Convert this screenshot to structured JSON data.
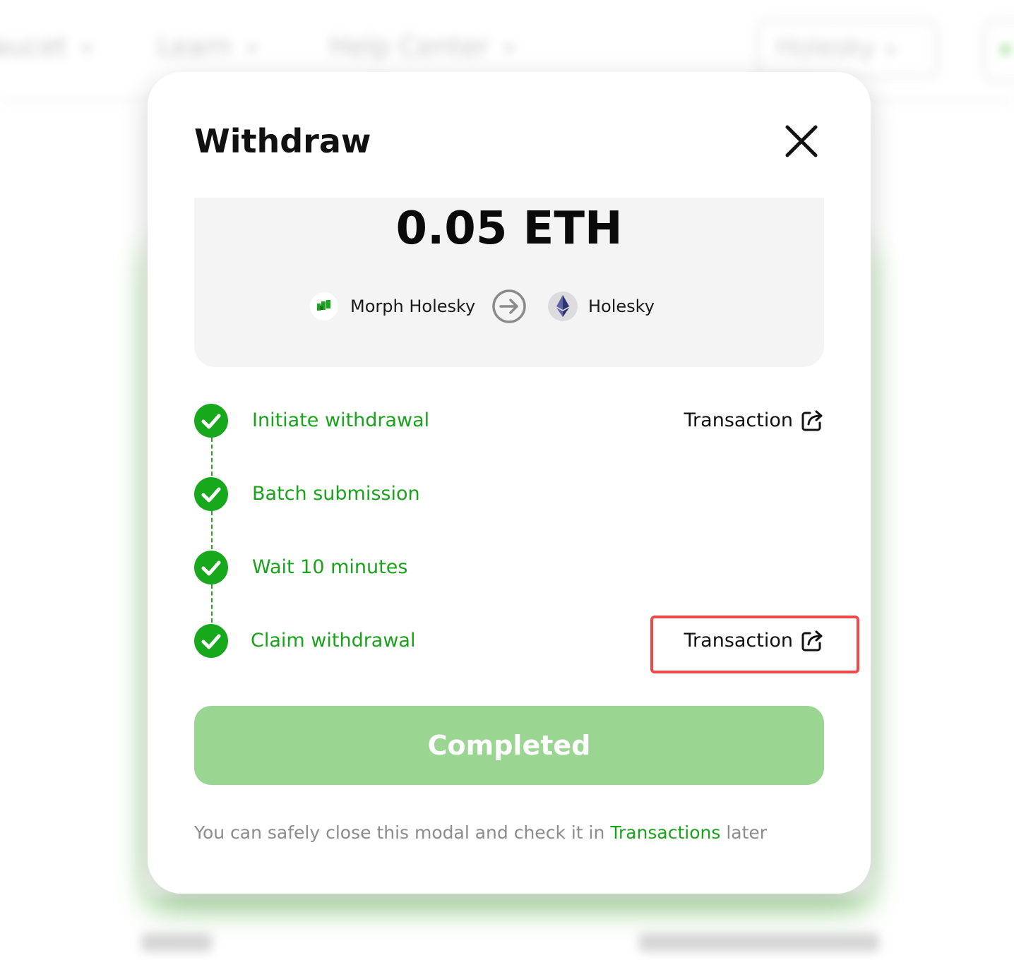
{
  "background": {
    "nav": [
      {
        "label": "Faucet"
      },
      {
        "label": "Learn"
      },
      {
        "label": "Help Center"
      }
    ],
    "network_label": "Holesky"
  },
  "modal": {
    "title": "Withdraw",
    "close_icon": "close-icon",
    "amount": "0.05 ETH",
    "route": {
      "from_label": "Morph Holesky",
      "from_icon": "morph-logo-icon",
      "arrow_icon": "arrow-right-circle-icon",
      "to_label": "Holesky",
      "to_icon": "ethereum-logo-icon"
    },
    "steps": [
      {
        "label": "Initiate withdrawal",
        "status": "done",
        "link_label": "Transaction"
      },
      {
        "label": "Batch submission",
        "status": "done"
      },
      {
        "label": "Wait 10 minutes",
        "status": "done"
      },
      {
        "label": "Claim withdrawal",
        "status": "done",
        "link_label": "Transaction"
      }
    ],
    "link_icon": "external-link-icon",
    "button_label": "Completed",
    "footnote": {
      "prefix": "You can safely close this modal and check it in",
      "link": "Transactions",
      "suffix": "later"
    }
  },
  "colors": {
    "success_green": "#19a31a",
    "check_green": "#18a81b",
    "button_green": "#9ad592",
    "highlight_red": "#ee4a4a",
    "text_dark": "#111111",
    "text_muted": "#8c8c8c"
  }
}
